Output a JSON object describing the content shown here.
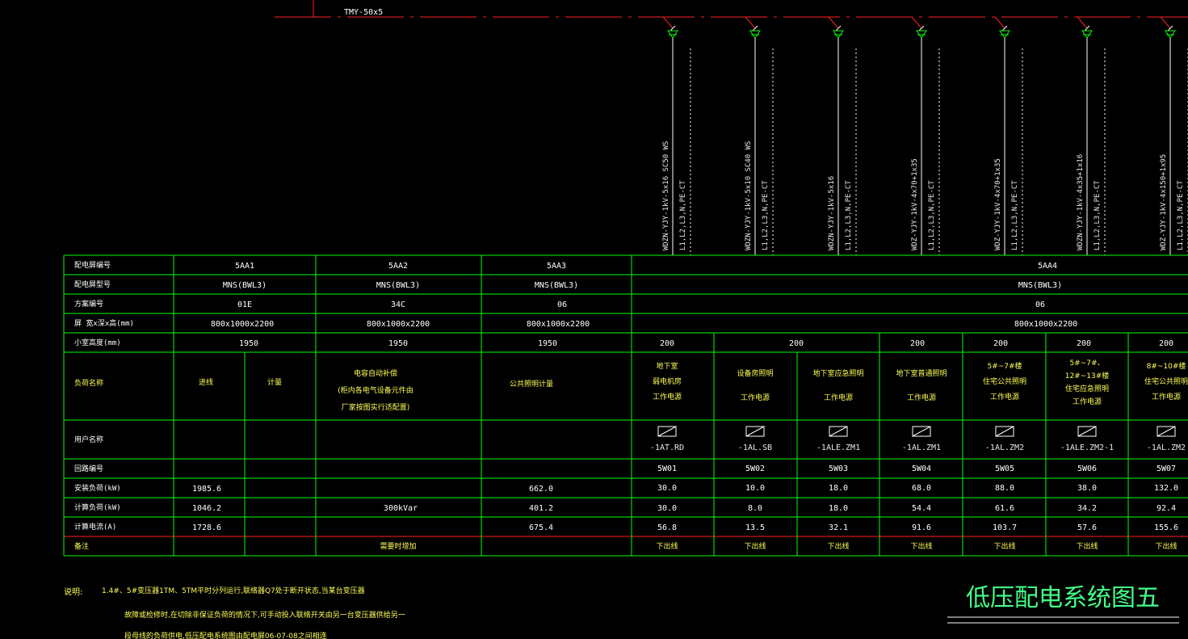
{
  "busbar_label": "TMY-50x5",
  "feeders": [
    {
      "cable": "WDZN-YJY-1kV-5x16",
      "conduit": "SC50 WS",
      "phases": "L1,L2,L3,N,PE-CT"
    },
    {
      "cable": "WDZN-YJY-1kV-5x10",
      "conduit": "SC40 WS",
      "phases": "L1,L2,L3,N,PE-CT"
    },
    {
      "cable": "WDZN-YJY-1kV-5x16",
      "conduit": "",
      "phases": "L1,L2,L3,N,PE-CT"
    },
    {
      "cable": "WDZ-YJY-1kV-4x70+1x35",
      "conduit": "",
      "phases": "L1,L2,L3,N,PE-CT"
    },
    {
      "cable": "WDZ-YJY-1kV-4x70+1x35",
      "conduit": "",
      "phases": "L1,L2,L3,N,PE-CT"
    },
    {
      "cable": "WDZN-YJY-1kV-4x35+1x16",
      "conduit": "",
      "phases": "L1,L2,L3,N,PE-CT"
    },
    {
      "cable": "WDZ-YJY-1kV-4x150+1x95",
      "conduit": "",
      "phases": "L1,L2,L3,N,PE-CT"
    }
  ],
  "row_headers": {
    "panel_no": "配电屏编号",
    "panel_model": "配电屏型号",
    "scheme_no": "方案编号",
    "dimensions": "屏 宽x深x高(mm)",
    "room_width": "小室高度(mm)",
    "load_name": "负荷名称",
    "user_name": "用户名称",
    "circuit_no": "回路编号",
    "installed_load": "安装负荷(kW)",
    "calc_load": "计算负荷(kW)",
    "calc_current": "计算电流(A)",
    "remarks": "备注"
  },
  "panels": [
    {
      "no": "5AA1",
      "model": "MNS(BWL3)",
      "scheme": "01E",
      "size": "800x1000x2200",
      "room": "1950"
    },
    {
      "no": "5AA2",
      "model": "MNS(BWL3)",
      "scheme": "34C",
      "size": "800x1000x2200",
      "room": "1950"
    },
    {
      "no": "5AA3",
      "model": "MNS(BWL3)",
      "scheme": "06",
      "size": "800x1000x2200",
      "room": "1950"
    },
    {
      "no": "5AA4",
      "model": "MNS(BWL3)",
      "scheme": "06",
      "size": "800x1000x2200"
    }
  ],
  "room_heights_5aa4": [
    "200",
    "200",
    "200",
    "200",
    "200",
    "200"
  ],
  "static_columns": {
    "incoming": "进线",
    "metering": "计量",
    "capacitor": [
      "电容自动补偿",
      "(柜内各电气设备元件由",
      "厂家按图实行适配置)"
    ],
    "lighting_meter": "公共照明计量",
    "installed_load_total": "1985.6",
    "calc_load_total": "1046.2",
    "calc_current_total": "1728.6",
    "capacitor_rating": "300kVar",
    "remark_capacitor": "需要时增加",
    "lighting_installed": "662.0",
    "lighting_calc_load": "401.2",
    "lighting_calc_current": "675.4"
  },
  "circuits": [
    {
      "load": [
        "地下室",
        "弱电机房",
        "工作电源"
      ],
      "user": "-1AT.RD",
      "circuit": "5W01",
      "installed": "30.0",
      "calc": "30.0",
      "current": "56.8",
      "remark": "下出线"
    },
    {
      "load": [
        "设备房照明",
        "工作电源"
      ],
      "user": "-1AL.SB",
      "circuit": "5W02",
      "installed": "10.0",
      "calc": "8.0",
      "current": "13.5",
      "remark": "下出线"
    },
    {
      "load": [
        "地下室应急照明",
        "工作电源"
      ],
      "user": "-1ALE.ZM1",
      "circuit": "5W03",
      "installed": "18.0",
      "calc": "18.0",
      "current": "32.1",
      "remark": "下出线"
    },
    {
      "load": [
        "地下室普通照明",
        "工作电源"
      ],
      "user": "-1AL.ZM1",
      "circuit": "5W04",
      "installed": "68.0",
      "calc": "54.4",
      "current": "91.6",
      "remark": "下出线"
    },
    {
      "load": [
        "5#~7#楼",
        "住宅公共照明",
        "工作电源"
      ],
      "user": "-1AL.ZM2",
      "circuit": "5W05",
      "installed": "88.0",
      "calc": "61.6",
      "current": "103.7",
      "remark": "下出线"
    },
    {
      "load": [
        "5#~7#、",
        "12#~13#楼",
        "住宅应急照明",
        "工作电源"
      ],
      "user": "-1ALE.ZM2-1",
      "circuit": "5W06",
      "installed": "38.0",
      "calc": "34.2",
      "current": "57.6",
      "remark": "下出线"
    },
    {
      "load": [
        "8#~10#楼",
        "住宅公共照明",
        "工作电源"
      ],
      "user": "-1AL.ZM2",
      "circuit": "5W07",
      "installed": "132.0",
      "calc": "92.4",
      "current": "155.6",
      "remark": "下出线"
    }
  ],
  "notes": {
    "label": "说明:",
    "lines": [
      "1.4#、5#变压器1TM、5TM平时分列运行,联络器Q7处于断开状态,当某台变压器",
      "故障或检修时,在切除非保证负荷的情况下,可手动投入联络开关由另一台变压器供给另一",
      "段母线的负荷供电,低压配电系统图由配电屏06-07-08之间相连"
    ]
  },
  "drawing_title": "低压配电系统图五",
  "colors": {
    "line": "#00ff00",
    "text": "#ffffff",
    "note": "#ffff55",
    "title": "#44ff88",
    "red": "#ff2020"
  }
}
